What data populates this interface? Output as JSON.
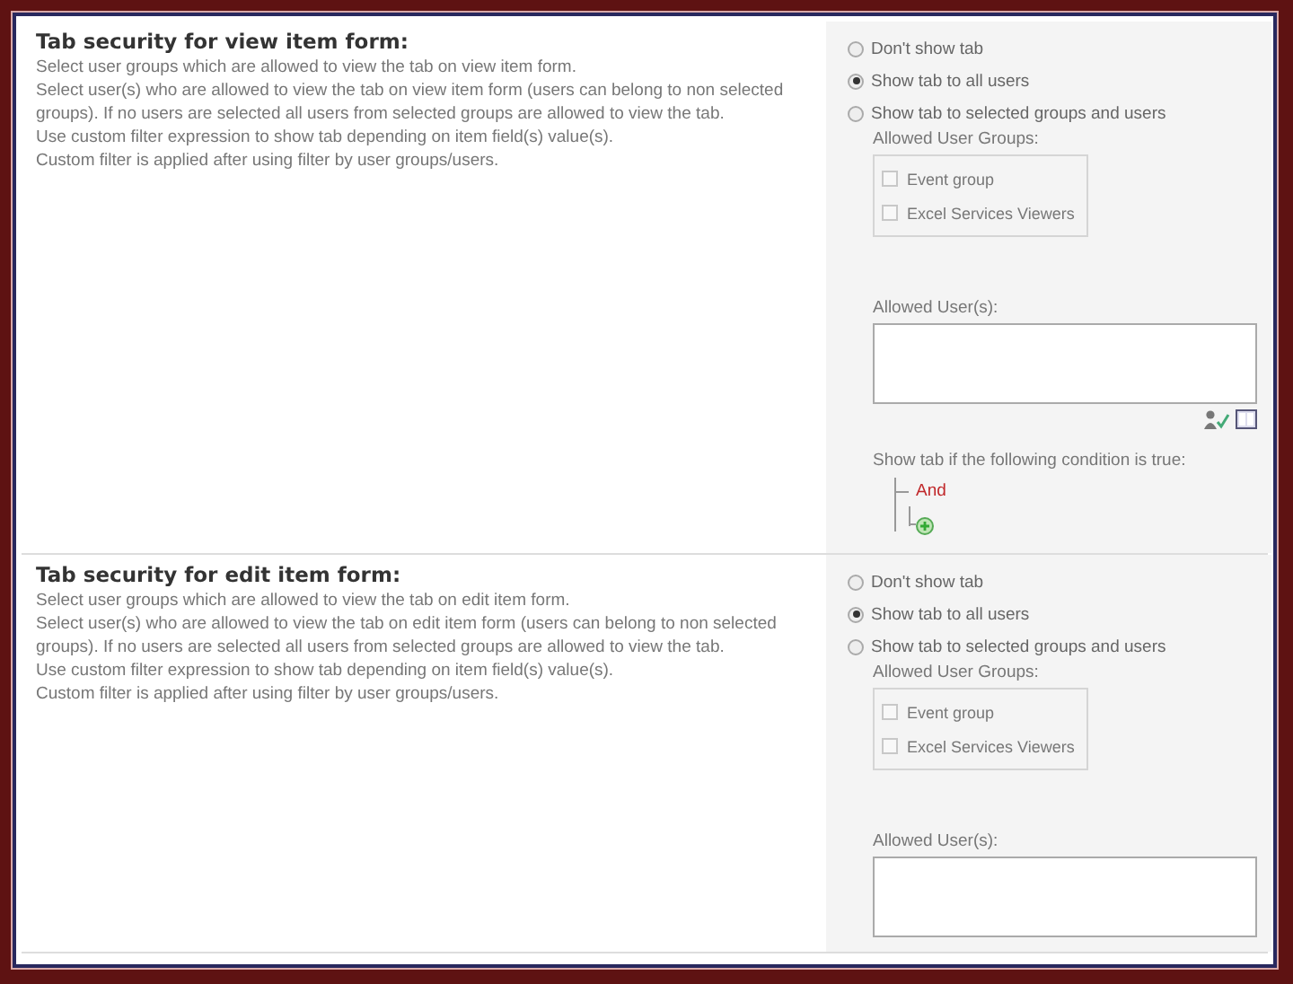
{
  "sections": [
    {
      "title": "Tab security for view item form:",
      "description": [
        "Select user groups which are allowed to view the tab on view item form.",
        "Select user(s) who are allowed to view the tab on view item form (users can belong to non selected groups). If no users are selected all users from selected groups are allowed to view the tab.",
        "Use custom filter expression to show tab depending on item field(s) value(s).",
        "Custom filter is applied after using filter by user groups/users."
      ],
      "options": [
        {
          "label": "Don't show tab",
          "selected": false
        },
        {
          "label": "Show tab to all users",
          "selected": true
        },
        {
          "label": "Show tab to selected groups and users",
          "selected": false
        }
      ],
      "groups_label": "Allowed User Groups:",
      "groups": [
        {
          "label": "Event group",
          "checked": false
        },
        {
          "label": "Excel Services Viewers",
          "checked": false
        }
      ],
      "users_label": "Allowed User(s):",
      "condition": {
        "label": "Show tab if the following condition is true:",
        "operator": "And"
      }
    },
    {
      "title": "Tab security for edit item form:",
      "description": [
        "Select user groups which are allowed to view the tab on edit item form.",
        "Select user(s) who are allowed to view the tab on edit item form (users can belong to non selected groups). If no users are selected all users from selected groups are allowed to view the tab.",
        "Use custom filter expression to show tab depending on item field(s) value(s).",
        "Custom filter is applied after using filter by user groups/users."
      ],
      "options": [
        {
          "label": "Don't show tab",
          "selected": false
        },
        {
          "label": "Show tab to all users",
          "selected": true
        },
        {
          "label": "Show tab to selected groups and users",
          "selected": false
        }
      ],
      "groups_label": "Allowed User Groups:",
      "groups": [
        {
          "label": "Event group",
          "checked": false
        },
        {
          "label": "Excel Services Viewers",
          "checked": false
        }
      ],
      "users_label": "Allowed User(s):"
    }
  ]
}
